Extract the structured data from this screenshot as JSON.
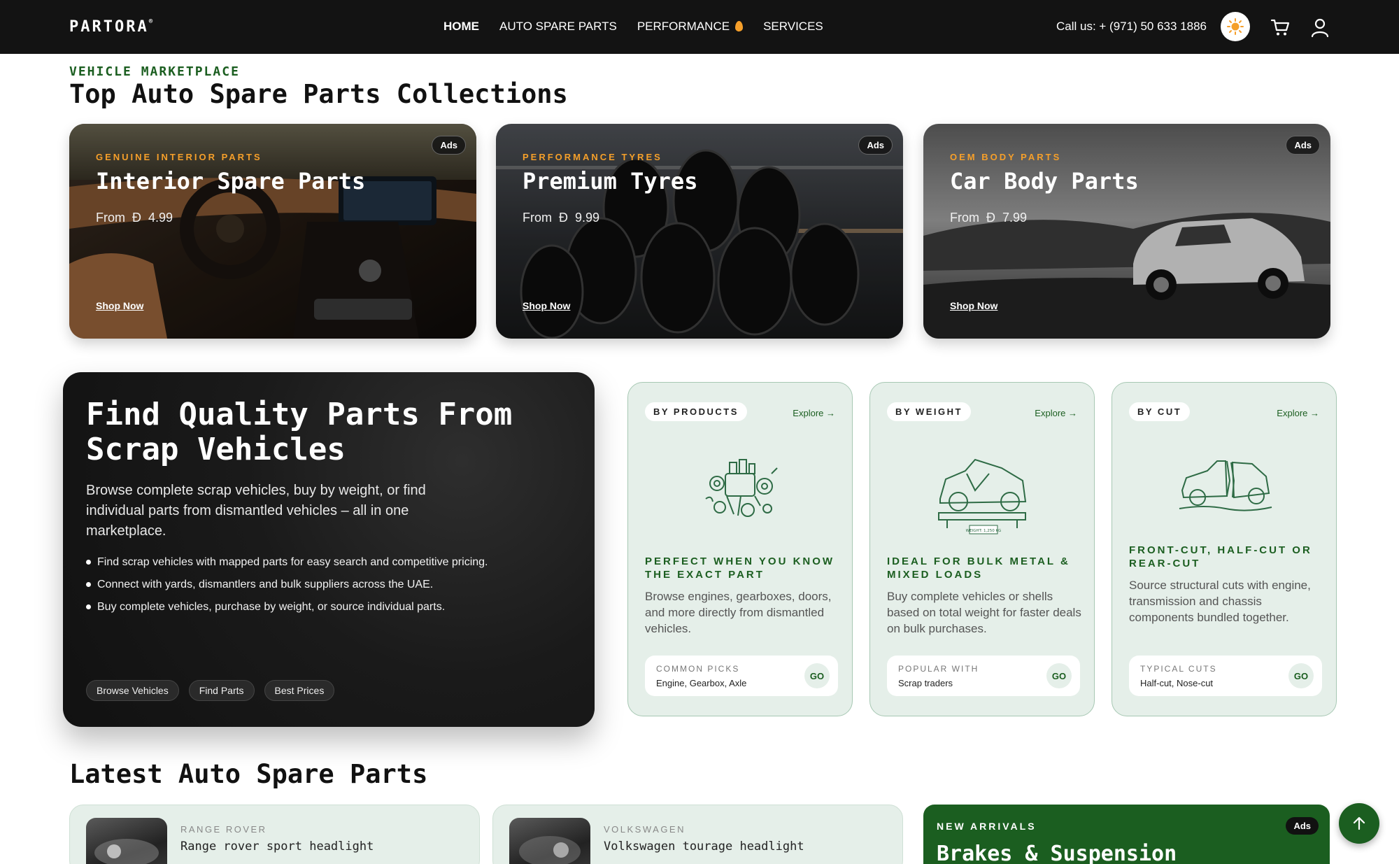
{
  "header": {
    "logo": "PARTORA",
    "logo_mark": "®",
    "nav": [
      {
        "label": "HOME",
        "active": true
      },
      {
        "label": "AUTO SPARE PARTS",
        "active": false
      },
      {
        "label": "PERFORMANCE",
        "active": false,
        "icon": "flame-icon"
      },
      {
        "label": "SERVICES",
        "active": false
      }
    ],
    "call": "Call us: + (971) 50 633 1886",
    "icons": [
      "sun-icon",
      "cart-icon",
      "user-icon"
    ]
  },
  "collections": {
    "eyebrow": "VEHICLE MARKETPLACE",
    "title": "Top Auto Spare Parts Collections",
    "cards": [
      {
        "kicker": "GENUINE INTERIOR PARTS",
        "title": "Interior Spare Parts",
        "price_prefix": "From",
        "currency": "Ð",
        "price": "4.99",
        "cta": "Shop Now",
        "badge": "Ads"
      },
      {
        "kicker": "PERFORMANCE TYRES",
        "title": "Premium Tyres",
        "price_prefix": "From",
        "currency": "Ð",
        "price": "9.99",
        "cta": "Shop Now",
        "badge": "Ads"
      },
      {
        "kicker": "OEM BODY PARTS",
        "title": "Car Body Parts",
        "price_prefix": "From",
        "currency": "Ð",
        "price": "7.99",
        "cta": "Shop Now",
        "badge": "Ads"
      }
    ]
  },
  "scrap": {
    "title": "Find Quality Parts From Scrap Vehicles",
    "lead": "Browse complete scrap vehicles, buy by weight, or find individual parts from dismantled vehicles – all in one marketplace.",
    "bullets": [
      "Find scrap vehicles with mapped parts for easy search and competitive pricing.",
      "Connect with yards, dismantlers and bulk suppliers across the UAE.",
      "Buy complete vehicles, purchase by weight, or source individual parts."
    ],
    "tags": [
      "Browse Vehicles",
      "Find Parts",
      "Best Prices"
    ]
  },
  "categories": [
    {
      "pill": "BY PRODUCTS",
      "explore": "Explore →",
      "heading": "PERFECT WHEN YOU KNOW THE EXACT PART",
      "desc": "Browse engines, gearboxes, doors, and more directly from dismantled vehicles.",
      "foot_label": "COMMON PICKS",
      "foot_value": "Engine, Gearbox, Axle",
      "go": "GO",
      "illustration": "engine-parts-icon"
    },
    {
      "pill": "BY WEIGHT",
      "explore": "Explore →",
      "heading": "IDEAL FOR BULK METAL & MIXED LOADS",
      "desc": "Buy complete vehicles or shells based on total weight for faster deals on bulk purchases.",
      "foot_label": "POPULAR WITH",
      "foot_value": "Scrap traders",
      "go": "GO",
      "illustration": "car-on-scale-icon",
      "scale_label": "WEIGHT: 1,250 KG"
    },
    {
      "pill": "BY CUT",
      "explore": "Explore →",
      "heading": "FRONT-CUT, HALF-CUT OR REAR-CUT",
      "desc": "Source structural cuts with engine, transmission and chassis components bundled together.",
      "foot_label": "TYPICAL CUTS",
      "foot_value": "Half-cut, Nose-cut",
      "go": "GO",
      "illustration": "cut-car-icon"
    }
  ],
  "latest": {
    "title": "Latest Auto Spare Parts",
    "items": [
      {
        "brand": "RANGE ROVER",
        "name": "Range rover sport headlight"
      },
      {
        "brand": "VOLKSWAGEN",
        "name": "Volkswagen tourage headlight"
      }
    ],
    "promo": {
      "kicker": "NEW ARRIVALS",
      "title": "Brakes & Suspension",
      "badge": "Ads"
    }
  },
  "colors": {
    "brand_green": "#1b5e20",
    "accent_orange": "#f59f2a",
    "header_bg": "#131313",
    "card_tint": "#e5efe9"
  }
}
